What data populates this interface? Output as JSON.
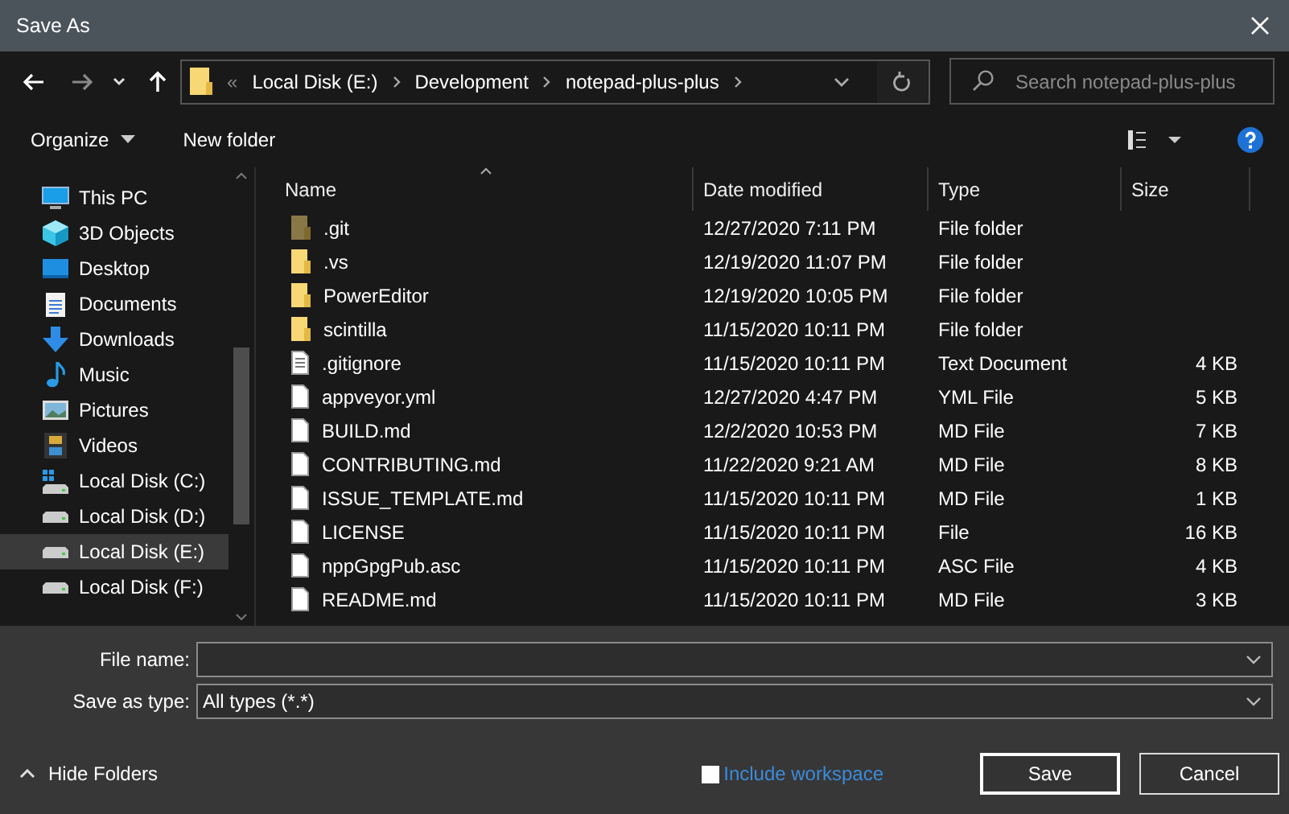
{
  "window": {
    "title": "Save As"
  },
  "address": {
    "overflow": "«",
    "segments": [
      "Local Disk (E:)",
      "Development",
      "notepad-plus-plus"
    ]
  },
  "search": {
    "placeholder": "Search notepad-plus-plus"
  },
  "toolbar": {
    "organize": "Organize",
    "new_folder": "New folder"
  },
  "sidebar": {
    "items": [
      {
        "label": "This PC",
        "kind": "pc",
        "selected": false
      },
      {
        "label": "3D Objects",
        "kind": "cube",
        "selected": false
      },
      {
        "label": "Desktop",
        "kind": "desktop",
        "selected": false
      },
      {
        "label": "Documents",
        "kind": "documents",
        "selected": false
      },
      {
        "label": "Downloads",
        "kind": "downloads",
        "selected": false
      },
      {
        "label": "Music",
        "kind": "music",
        "selected": false
      },
      {
        "label": "Pictures",
        "kind": "pictures",
        "selected": false
      },
      {
        "label": "Videos",
        "kind": "videos",
        "selected": false
      },
      {
        "label": "Local Disk (C:)",
        "kind": "system-disk",
        "selected": false
      },
      {
        "label": "Local Disk (D:)",
        "kind": "disk",
        "selected": false
      },
      {
        "label": "Local Disk (E:)",
        "kind": "disk",
        "selected": true
      },
      {
        "label": "Local Disk (F:)",
        "kind": "disk",
        "selected": false
      }
    ]
  },
  "table": {
    "columns": [
      "Name",
      "Date modified",
      "Type",
      "Size"
    ],
    "rows": [
      {
        "name": ".git",
        "date": "12/27/2020 7:11 PM",
        "type": "File folder",
        "kind": "folder",
        "hidden": true
      },
      {
        "name": ".vs",
        "date": "12/19/2020 11:07 PM",
        "type": "File folder",
        "kind": "folder",
        "hidden": false
      },
      {
        "name": "PowerEditor",
        "date": "12/19/2020 10:05 PM",
        "type": "File folder",
        "kind": "folder",
        "hidden": false
      },
      {
        "name": "scintilla",
        "date": "11/15/2020 10:11 PM",
        "type": "File folder",
        "kind": "folder",
        "hidden": false
      },
      {
        "name": ".gitignore",
        "date": "11/15/2020 10:11 PM",
        "type": "Text Document",
        "size": "4 KB",
        "kind": "text",
        "hidden": false
      },
      {
        "name": "appveyor.yml",
        "date": "12/27/2020 4:47 PM",
        "type": "YML File",
        "size": "5 KB",
        "kind": "file",
        "hidden": false
      },
      {
        "name": "BUILD.md",
        "date": "12/2/2020 10:53 PM",
        "type": "MD File",
        "size": "7 KB",
        "kind": "file",
        "hidden": false
      },
      {
        "name": "CONTRIBUTING.md",
        "date": "11/22/2020 9:21 AM",
        "type": "MD File",
        "size": "8 KB",
        "kind": "file",
        "hidden": false
      },
      {
        "name": "ISSUE_TEMPLATE.md",
        "date": "11/15/2020 10:11 PM",
        "type": "MD File",
        "size": "1 KB",
        "kind": "file",
        "hidden": false
      },
      {
        "name": "LICENSE",
        "date": "11/15/2020 10:11 PM",
        "type": "File",
        "size": "16 KB",
        "kind": "file",
        "hidden": false
      },
      {
        "name": "nppGpgPub.asc",
        "date": "11/15/2020 10:11 PM",
        "type": "ASC File",
        "size": "4 KB",
        "kind": "file",
        "hidden": false
      },
      {
        "name": "README.md",
        "date": "11/15/2020 10:11 PM",
        "type": "MD File",
        "size": "3 KB",
        "kind": "file",
        "hidden": false
      }
    ]
  },
  "form": {
    "file_name_label": "File name:",
    "type_label": "Save as type:",
    "type_value": "All types (*.*)"
  },
  "footer": {
    "hide_folders": "Hide Folders",
    "include_workspace": {
      "label": "Include workspace",
      "checked": false
    },
    "buttons": [
      "Save",
      "Cancel"
    ]
  }
}
